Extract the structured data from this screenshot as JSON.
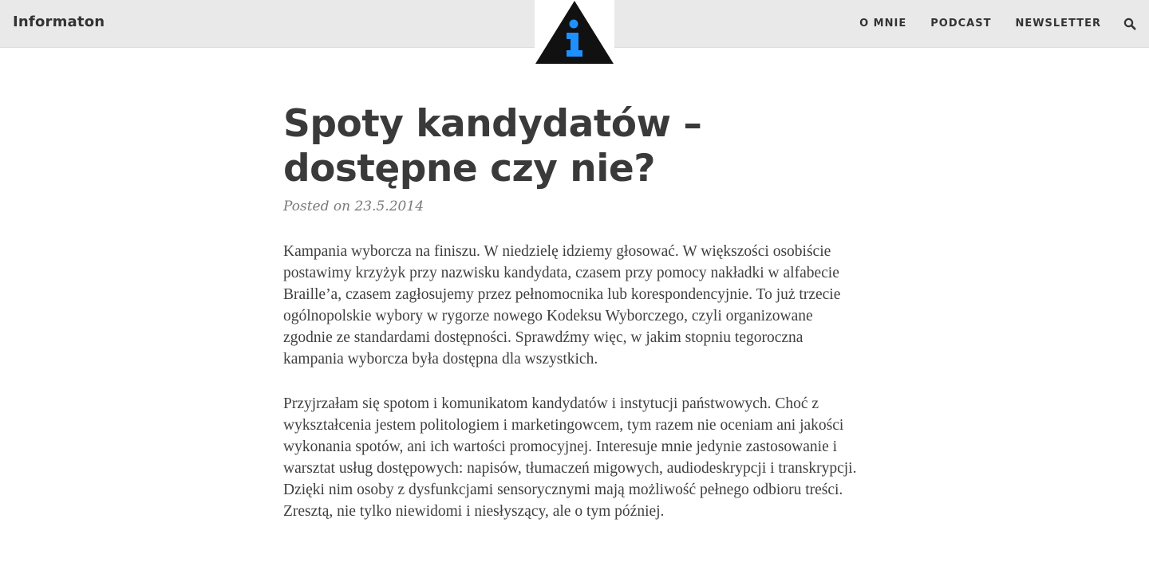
{
  "header": {
    "site_title": "Informaton",
    "nav": {
      "about": "O MNIE",
      "podcast": "PODCAST",
      "newsletter": "NEWSLETTER"
    },
    "search_icon": "search-icon",
    "logo_icon": "info-triangle-logo",
    "colors": {
      "bar": "#e9e9e9",
      "logo_triangle": "#111111",
      "logo_letter": "#1e90ff"
    }
  },
  "post": {
    "title": "Spoty kandydatów – dostępne czy nie?",
    "meta_prefix": "Posted on",
    "date": "23.5.2014",
    "paragraphs": [
      "Kampania wyborcza na finiszu. W niedzielę idziemy głosować. W większości osobiście postawimy krzyżyk przy nazwisku kandydata, czasem przy pomocy nakładki w alfabecie Braille’a, czasem zagłosujemy przez pełnomocnika lub korespondencyjnie. To już trzecie ogólnopolskie wybory w rygorze nowego Kodeksu Wyborczego, czyli organizowane zgodnie ze standardami dostępności. Sprawdźmy więc, w jakim stopniu tegoroczna kampania wyborcza była dostępna dla wszystkich.",
      "Przyjrzałam się spotom i komunikatom kandydatów i instytucji państwowych. Choć z wykształcenia jestem politologiem i marketingowcem, tym razem nie oceniam ani jakości wykonania spotów, ani ich wartości promocyjnej. Interesuje mnie jedynie zastosowanie i warsztat usług dostępowych: napisów, tłumaczeń migowych, audiodeskrypcji i transkrypcji. Dzięki nim osoby z dysfunkcjami sensorycznymi mają możliwość pełnego odbioru treści. Zresztą, nie tylko niewidomi i niesłyszący, ale o tym później."
    ]
  }
}
